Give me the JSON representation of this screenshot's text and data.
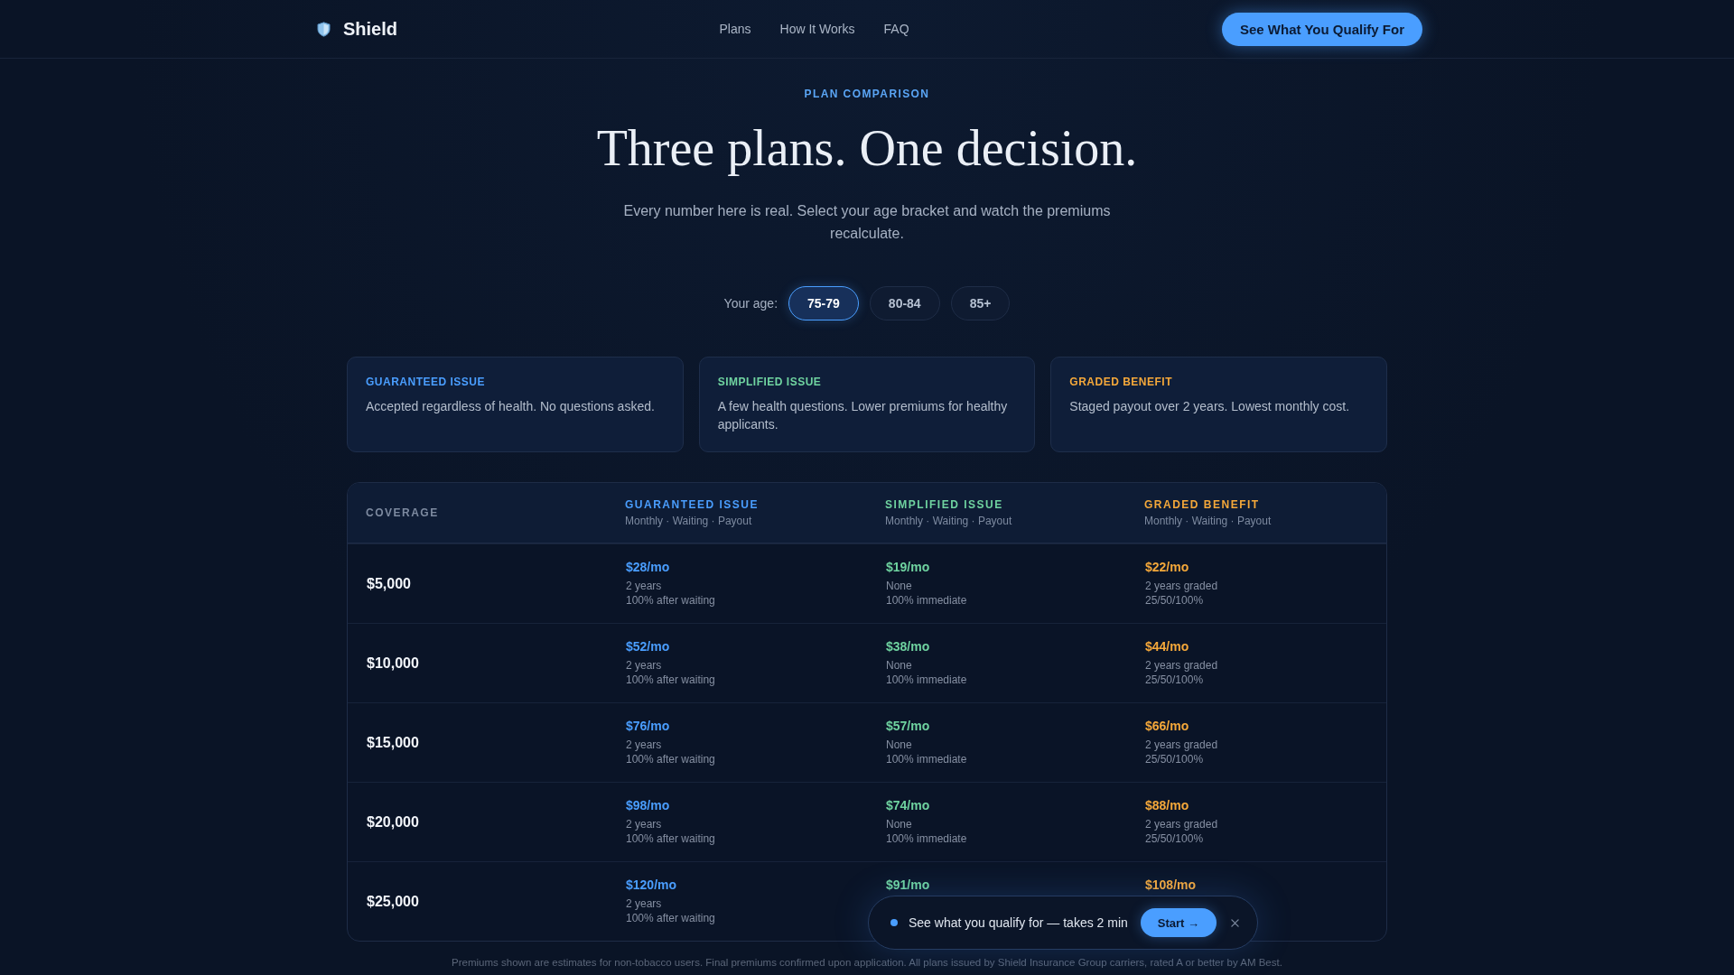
{
  "header": {
    "brand": "Shield",
    "nav": [
      "Plans",
      "How It Works",
      "FAQ"
    ],
    "cta": "See What You Qualify For"
  },
  "hero": {
    "eyebrow": "PLAN COMPARISON",
    "title": "Three plans. One decision.",
    "subtitle": "Every number here is real. Select your age bracket and watch the premiums recalculate."
  },
  "age_selector": {
    "label": "Your age:",
    "options": [
      {
        "label": "75-79",
        "selected": true
      },
      {
        "label": "80-84",
        "selected": false
      },
      {
        "label": "85+",
        "selected": false
      }
    ]
  },
  "plans": [
    {
      "name": "GUARANTEED ISSUE",
      "description": "Accepted regardless of health. No questions asked.",
      "color": "#4a9eff"
    },
    {
      "name": "SIMPLIFIED ISSUE",
      "description": "A few health questions. Lower premiums for healthy applicants.",
      "color": "#6fd3a0"
    },
    {
      "name": "GRADED BENEFIT",
      "description": "Staged payout over 2 years. Lowest monthly cost.",
      "color": "#f5a83a"
    }
  ],
  "table": {
    "columns": [
      {
        "kind": "coverage",
        "label": "COVERAGE"
      },
      {
        "kind": "plan",
        "label": "GUARANTEED ISSUE",
        "subtitle": "Monthly · Waiting · Payout",
        "color": "#4a9eff"
      },
      {
        "kind": "plan",
        "label": "SIMPLIFIED ISSUE",
        "subtitle": "Monthly · Waiting · Payout",
        "color": "#6fd3a0"
      },
      {
        "kind": "plan",
        "label": "GRADED BENEFIT",
        "subtitle": "Monthly · Waiting · Payout",
        "color": "#f5a83a"
      }
    ],
    "rows": [
      {
        "cells": [
          {
            "value": "$5,000"
          },
          {
            "monthly": "$28/mo",
            "waiting": "2 years",
            "payout": "100% after waiting"
          },
          {
            "monthly": "$19/mo",
            "waiting": "None",
            "payout": "100% immediate"
          },
          {
            "monthly": "$22/mo",
            "waiting": "2 years graded",
            "payout": "25/50/100%"
          }
        ]
      },
      {
        "cells": [
          {
            "value": "$10,000"
          },
          {
            "monthly": "$52/mo",
            "waiting": "2 years",
            "payout": "100% after waiting"
          },
          {
            "monthly": "$38/mo",
            "waiting": "None",
            "payout": "100% immediate"
          },
          {
            "monthly": "$44/mo",
            "waiting": "2 years graded",
            "payout": "25/50/100%"
          }
        ]
      },
      {
        "cells": [
          {
            "value": "$15,000"
          },
          {
            "monthly": "$76/mo",
            "waiting": "2 years",
            "payout": "100% after waiting"
          },
          {
            "monthly": "$57/mo",
            "waiting": "None",
            "payout": "100% immediate"
          },
          {
            "monthly": "$66/mo",
            "waiting": "2 years graded",
            "payout": "25/50/100%"
          }
        ]
      },
      {
        "cells": [
          {
            "value": "$20,000"
          },
          {
            "monthly": "$98/mo",
            "waiting": "2 years",
            "payout": "100% after waiting"
          },
          {
            "monthly": "$74/mo",
            "waiting": "None",
            "payout": "100% immediate"
          },
          {
            "monthly": "$88/mo",
            "waiting": "2 years graded",
            "payout": "25/50/100%"
          }
        ]
      },
      {
        "cells": [
          {
            "value": "$25,000"
          },
          {
            "monthly": "$120/mo",
            "waiting": "2 years",
            "payout": "100% after waiting"
          },
          {
            "monthly": "$91/mo"
          },
          {
            "monthly": "$108/mo"
          }
        ]
      }
    ]
  },
  "toast": {
    "message": "See what you qualify for — takes 2 min",
    "button": "Start →"
  },
  "footnote": "Premiums shown are estimates for non-tobacco users. Final premiums confirmed upon application. All plans issued by Shield Insurance Group carriers, rated A or better by AM Best."
}
